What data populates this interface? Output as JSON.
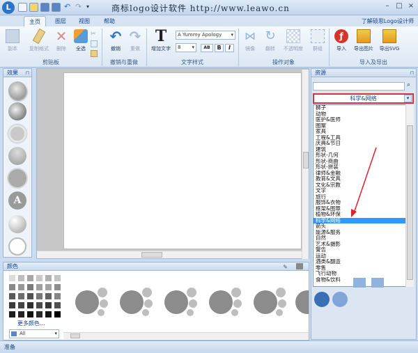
{
  "title": "商标logo设计软件  http://www.leawo.cn",
  "app_logo_letter": "L",
  "tabs": [
    "主页",
    "图层",
    "视图",
    "帮助"
  ],
  "help_link": "了解硕思Logo设计师",
  "ribbon": {
    "clipboard": {
      "label": "剪贴板",
      "buttons": [
        "副本",
        "复制格式",
        "删除",
        "全选"
      ]
    },
    "undo": {
      "label": "撤销与重做",
      "buttons": [
        "撤销",
        "重做"
      ]
    },
    "text": {
      "label": "文字样式",
      "add_text": "增加文字",
      "font": "A Yummy Apology",
      "size": "8",
      "bold": "B",
      "italic": "I",
      "spacing": "AB"
    },
    "arrange": {
      "label": "操作对象",
      "buttons": [
        "镜像",
        "翻转",
        "不透明度",
        "群组"
      ]
    },
    "export": {
      "label": "导入及导出",
      "buttons": [
        "导入",
        "导出图片",
        "导出SVG"
      ]
    }
  },
  "effects": {
    "title": "效果",
    "text_effect_glyph": "A"
  },
  "colors": {
    "title": "颜色",
    "more": "更多颜色...",
    "filter": "All"
  },
  "resources": {
    "title": "资源",
    "selected": "科学&网络",
    "categories": [
      "狮子",
      "动物",
      "医护&医师",
      "图案",
      "家具",
      "工程&工具",
      "庆典&节日",
      "建筑",
      "形状-几何",
      "形状-商曲",
      "形状-拼装",
      "律师&金融",
      "教育&文具",
      "文化&宗教",
      "文字",
      "旅行",
      "服饰&衣物",
      "框架&图章",
      "植物&环保",
      "科学&网络",
      "箭头",
      "能源&服务",
      "自然",
      "艺术&摄影",
      "警告",
      "运动",
      "酒类&翻造",
      "零售",
      "飞行动物",
      "食物&饮料"
    ]
  },
  "status": "准备"
}
